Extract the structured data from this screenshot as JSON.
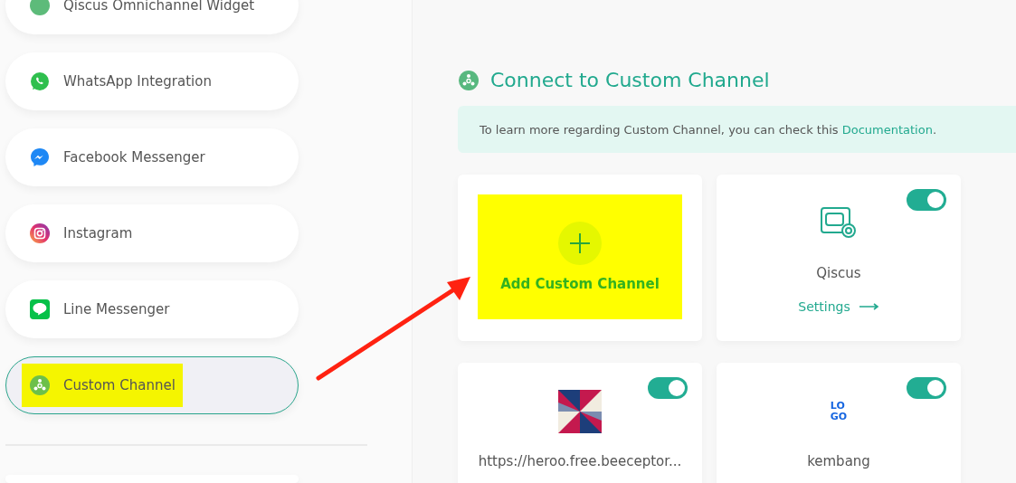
{
  "sidebar": {
    "items": [
      {
        "label": "Qiscus Omnichannel Widget",
        "selected": false,
        "highlighted": false
      },
      {
        "label": "WhatsApp Integration",
        "selected": false,
        "highlighted": false
      },
      {
        "label": "Facebook Messenger",
        "selected": false,
        "highlighted": false
      },
      {
        "label": "Instagram",
        "selected": false,
        "highlighted": false
      },
      {
        "label": "Line Messenger",
        "selected": false,
        "highlighted": false
      },
      {
        "label": "Custom Channel",
        "selected": true,
        "highlighted": true
      }
    ]
  },
  "header": {
    "title": "Connect to Custom Channel"
  },
  "banner": {
    "text": "To learn more regarding Custom Channel, you can check this ",
    "link": "Documentation",
    "end": "."
  },
  "cards": [
    {
      "kind": "add",
      "label": "Add Custom Channel",
      "highlighted": true
    },
    {
      "kind": "device",
      "name": "Qiscus",
      "on": true,
      "action": "Settings"
    },
    {
      "kind": "picture",
      "name": "https://heroo.free.beeceptor...",
      "on": true
    },
    {
      "kind": "textlogo",
      "logo_lines": [
        "LO",
        "GO"
      ],
      "name": "kembang",
      "on": true
    }
  ]
}
